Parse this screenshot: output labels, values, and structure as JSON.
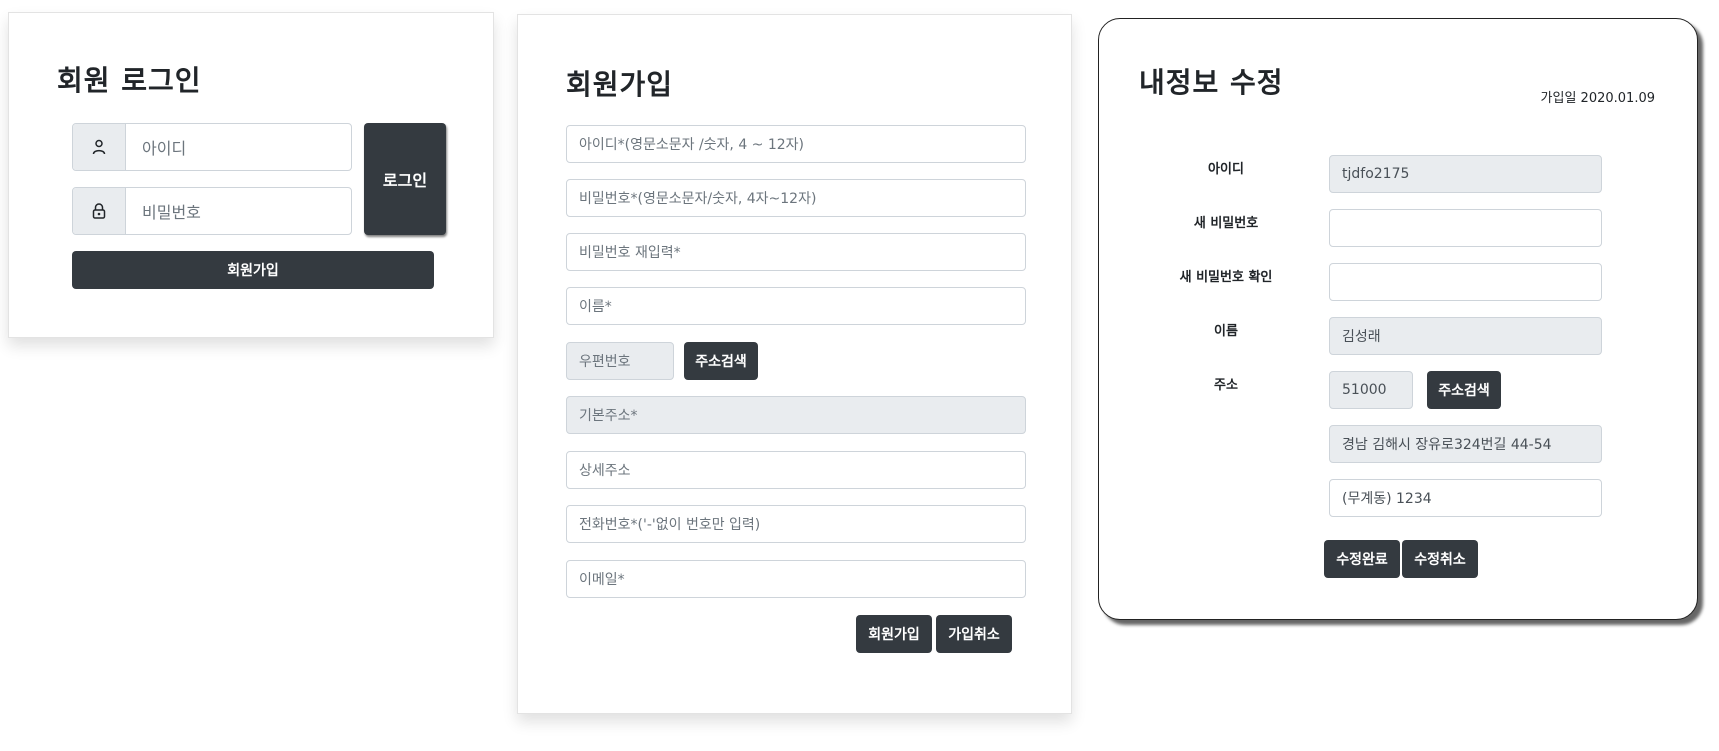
{
  "login": {
    "title": "회원 로그인",
    "id_placeholder": "아이디",
    "password_placeholder": "비밀번호",
    "login_button": "로그인",
    "signup_button": "회원가입"
  },
  "signup": {
    "title": "회원가입",
    "fields": {
      "id": "아이디*(영문소문자 /숫자, 4 ~ 12자)",
      "password": "비밀번호*(영문소문자/숫자, 4자~12자)",
      "password_confirm": "비밀번호 재입력*",
      "name": "이름*",
      "postcode": "우편번호",
      "base_address": "기본주소*",
      "detail_address": "상세주소",
      "phone": "전화번호*('-'없이 번호만 입력)",
      "email": "이메일*"
    },
    "address_search_button": "주소검색",
    "submit_button": "회원가입",
    "cancel_button": "가입취소"
  },
  "profile": {
    "title": "내정보 수정",
    "join_date": "가입일 2020.01.09",
    "labels": {
      "id": "아이디",
      "new_password": "새 비밀번호",
      "confirm_password": "새 비밀번호 확인",
      "name": "이름",
      "address": "주소"
    },
    "values": {
      "id": "tjdfo2175",
      "new_password": "",
      "confirm_password": "",
      "name": "김성래",
      "postcode": "51000",
      "base_address": "경남 김해시 장유로324번길 44-54",
      "detail_address": "(무계동) 1234"
    },
    "address_search_button": "주소검색",
    "save_button": "수정완료",
    "cancel_button": "수정취소"
  },
  "colors": {
    "button_dark": "#343a40",
    "readonly_bg": "#e9ecef",
    "border": "#ced4da"
  },
  "icons": [
    "person-icon",
    "lock-icon"
  ]
}
